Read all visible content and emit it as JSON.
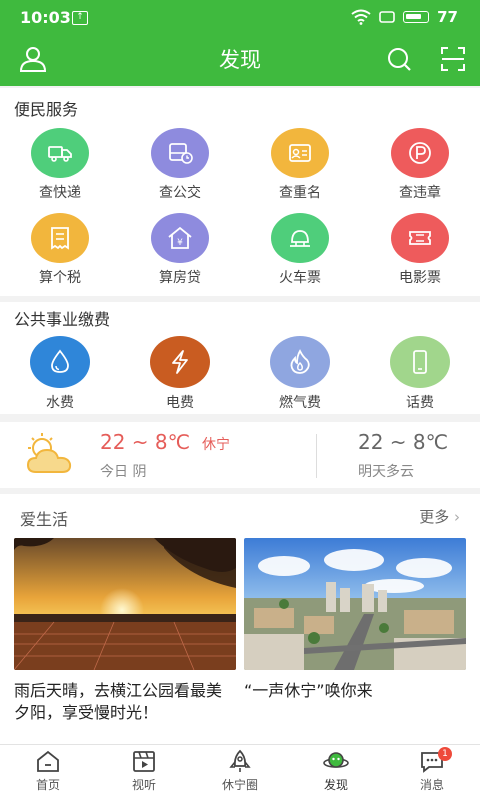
{
  "status": {
    "time": "10:03",
    "battery": "77"
  },
  "header": {
    "title": "发现"
  },
  "convenience": {
    "title": "便民服务",
    "items": [
      {
        "label": "查快递",
        "icon": "truck-icon",
        "color": "#4fce7b"
      },
      {
        "label": "查公交",
        "icon": "bus-icon",
        "color": "#8e8bde"
      },
      {
        "label": "查重名",
        "icon": "id-card-icon",
        "color": "#f2b63d"
      },
      {
        "label": "查违章",
        "icon": "parking-icon",
        "color": "#ee5b5c"
      },
      {
        "label": "算个税",
        "icon": "receipt-icon",
        "color": "#f2b63d"
      },
      {
        "label": "算房贷",
        "icon": "house-yen-icon",
        "color": "#8e8bde"
      },
      {
        "label": "火车票",
        "icon": "train-icon",
        "color": "#4fce7b"
      },
      {
        "label": "电影票",
        "icon": "ticket-icon",
        "color": "#ee5b5c"
      }
    ]
  },
  "utilities": {
    "title": "公共事业缴费",
    "items": [
      {
        "label": "水费",
        "icon": "water-drop-icon",
        "color": "#2f86d9"
      },
      {
        "label": "电费",
        "icon": "lightning-icon",
        "color": "#c95c21"
      },
      {
        "label": "燃气费",
        "icon": "flame-icon",
        "color": "#8fa6e0"
      },
      {
        "label": "话费",
        "icon": "phone-icon",
        "color": "#a1d68c"
      }
    ]
  },
  "weather": {
    "today_temp": "22 ~ 8℃",
    "city": "休宁",
    "today_desc": "今日 阴",
    "tomorrow_temp": "22 ~ 8℃",
    "tomorrow_desc": "明天多云"
  },
  "life": {
    "title": "爱生活",
    "more": "更多",
    "cards": [
      {
        "title": "雨后天晴，去横江公园看最美夕阳，享受慢时光！"
      },
      {
        "title": "“一声休宁”唤你来"
      }
    ]
  },
  "nav": [
    {
      "label": "首页",
      "icon": "home-icon"
    },
    {
      "label": "视听",
      "icon": "film-icon"
    },
    {
      "label": "休宁圈",
      "icon": "rocket-icon"
    },
    {
      "label": "发现",
      "icon": "discover-planet-icon",
      "active": true
    },
    {
      "label": "消息",
      "icon": "message-icon",
      "badge": "1"
    }
  ]
}
